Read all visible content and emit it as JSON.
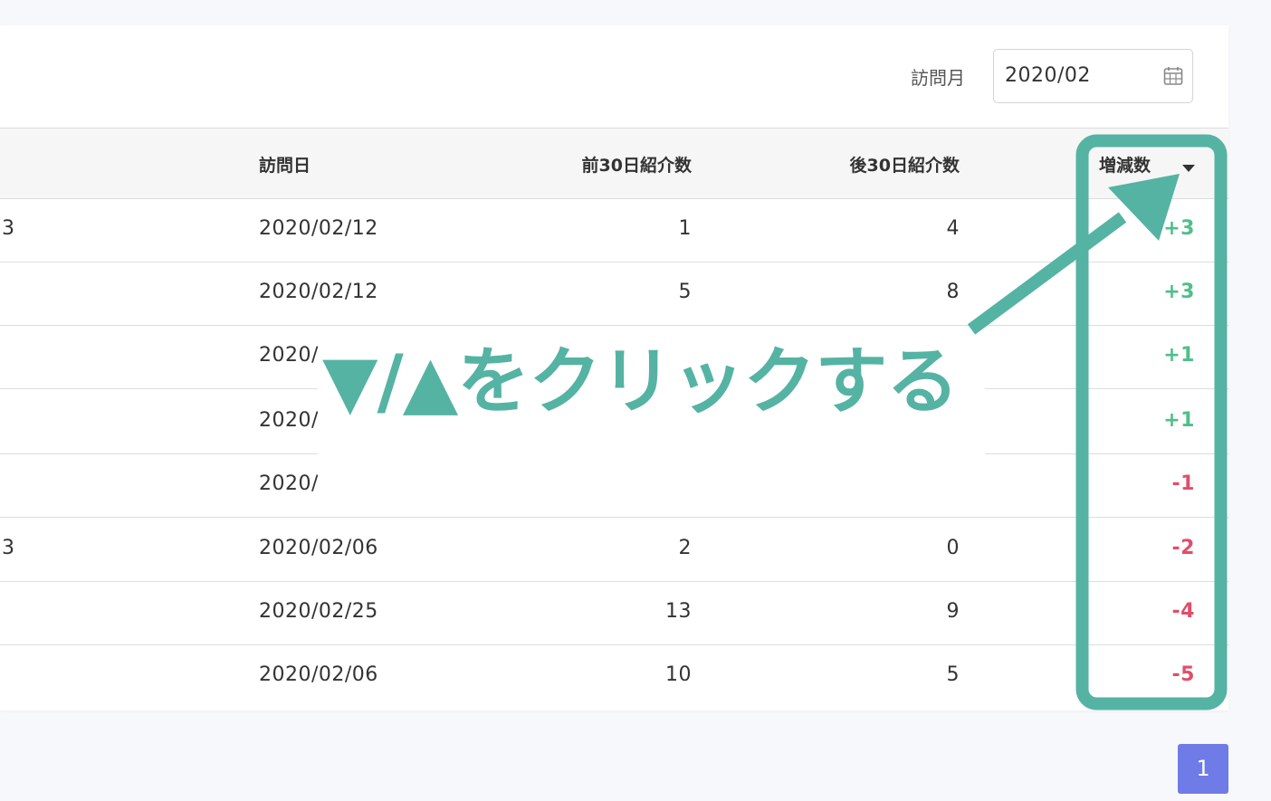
{
  "filter": {
    "label": "訪問月",
    "value": "2020/02"
  },
  "table": {
    "headers": {
      "visit_date": "訪問日",
      "before30": "前30日紹介数",
      "after30": "後30日紹介数",
      "diff": "増減数"
    },
    "rows": [
      {
        "name": "3",
        "visit_date": "2020/02/12",
        "before30": "1",
        "after30": "4",
        "diff": "+3"
      },
      {
        "name": "",
        "visit_date": "2020/02/12",
        "before30": "5",
        "after30": "8",
        "diff": "+3"
      },
      {
        "name": "",
        "visit_date": "2020/",
        "before30": "",
        "after30": "",
        "diff": "+1"
      },
      {
        "name": "",
        "visit_date": "2020/",
        "before30": "",
        "after30": "",
        "diff": "+1"
      },
      {
        "name": "",
        "visit_date": "2020/",
        "before30": "",
        "after30": "",
        "diff": "-1"
      },
      {
        "name": "3",
        "visit_date": "2020/02/06",
        "before30": "2",
        "after30": "0",
        "diff": "-2"
      },
      {
        "name": "",
        "visit_date": "2020/02/25",
        "before30": "13",
        "after30": "9",
        "diff": "-4"
      },
      {
        "name": "",
        "visit_date": "2020/02/06",
        "before30": "10",
        "after30": "5",
        "diff": "-5"
      }
    ]
  },
  "annotation": {
    "text": "▼/▲をクリックする",
    "color": "#55b3a3"
  },
  "pagination": {
    "current": "1"
  },
  "colors": {
    "positive": "#4fbf8a",
    "negative": "#e04e6a",
    "accent": "#6f7be6"
  }
}
